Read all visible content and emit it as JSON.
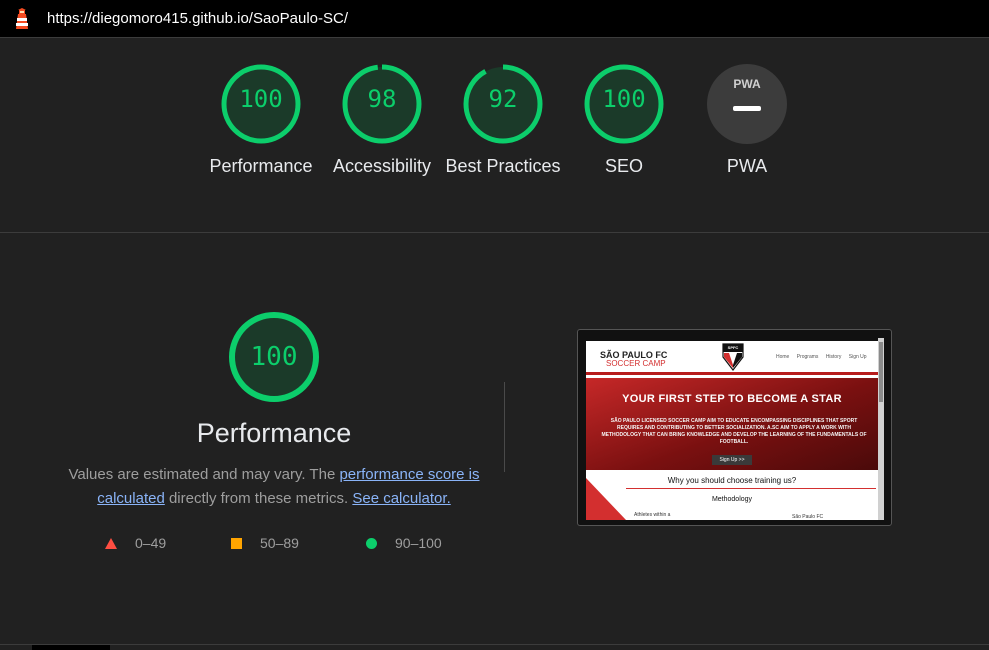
{
  "header": {
    "url": "https://diegomoro415.github.io/SaoPaulo-SC/",
    "logo_icon": "lighthouse-icon"
  },
  "gauges": [
    {
      "score": "100",
      "label": "Performance",
      "value": 100
    },
    {
      "score": "98",
      "label": "Accessibility",
      "value": 98
    },
    {
      "score": "92",
      "label": "Best Practices",
      "value": 92
    },
    {
      "score": "100",
      "label": "SEO",
      "value": 100
    },
    {
      "badge": "PWA",
      "label": "PWA"
    }
  ],
  "detail": {
    "score": "100",
    "title": "Performance",
    "desc_part1": "Values are estimated and may vary. The ",
    "link1": "performance score is calculated",
    "desc_part2": " directly from these metrics. ",
    "link2": "See calculator."
  },
  "legend": {
    "fail": "0–49",
    "average": "50–89",
    "pass": "90–100"
  },
  "colors": {
    "pass": "#0cce6b",
    "average": "#ffa400",
    "fail": "#ff4e42",
    "link": "#8ab4f8",
    "background": "#212121"
  },
  "screenshot": {
    "brand_line1": "SÃO PAULO FC",
    "brand_line2": "SOCCER CAMP",
    "crest_text": "SPFC",
    "nav_links": [
      "Home",
      "Programs",
      "History",
      "Sign Up"
    ],
    "hero_title": "YOUR FIRST STEP TO BECOME A STAR",
    "hero_text": "SÃO PAULO LICENSED SOCCER CAMP AIM TO EDUCATE ENCOMPASSING DISCIPLINES THAT SPORT REQUIRES AND CONTRIBUTING TO BETTER SOCIALIZATION. A.SC AIM TO APPLY A WORK WITH METHODOLOGY THAT CAN BRING KNOWLEDGE AND DEVELOP THE LEARNING OF THE FUNDAMENTALS OF FOOTBALL.",
    "hero_button": "Sign Up >>",
    "why_title": "Why you should choose training us?",
    "methodology": "Methodology",
    "item1": "Athletes within a",
    "item2": "São Paulo FC"
  }
}
